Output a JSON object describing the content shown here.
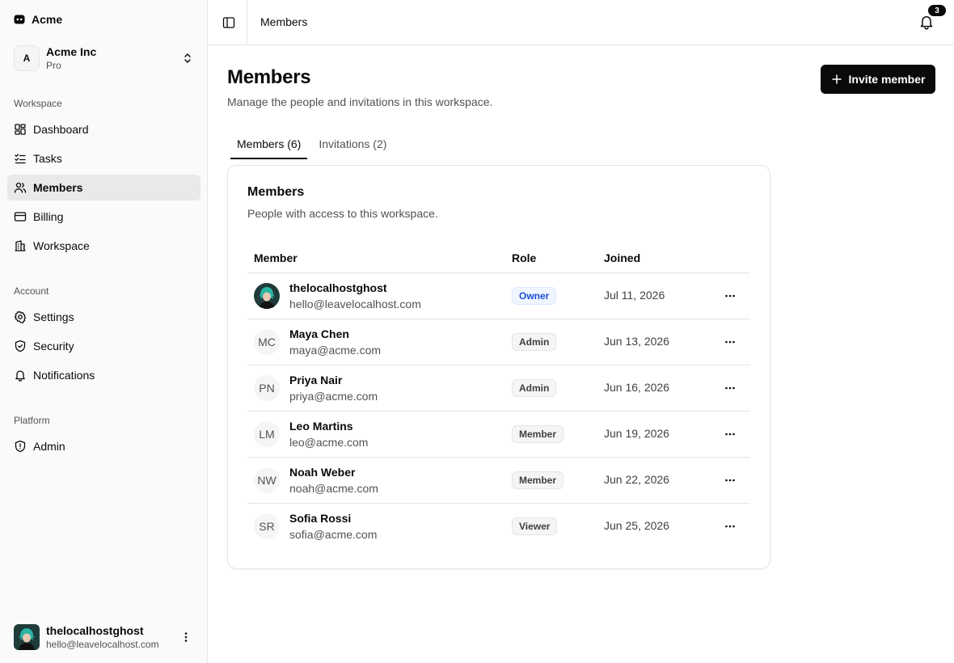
{
  "brand": {
    "name": "Acme"
  },
  "team": {
    "initial": "A",
    "name": "Acme Inc",
    "plan": "Pro"
  },
  "sidebar": {
    "groups": [
      {
        "label": "Workspace"
      },
      {
        "label": "Account"
      },
      {
        "label": "Platform"
      }
    ],
    "items": [
      {
        "label": "Dashboard",
        "icon": "dashboard-icon"
      },
      {
        "label": "Tasks",
        "icon": "tasks-icon"
      },
      {
        "label": "Members",
        "icon": "users-icon",
        "active": true
      },
      {
        "label": "Billing",
        "icon": "credit-card-icon"
      },
      {
        "label": "Workspace",
        "icon": "building-icon"
      },
      {
        "label": "Settings",
        "icon": "gear-icon"
      },
      {
        "label": "Security",
        "icon": "shield-icon"
      },
      {
        "label": "Notifications",
        "icon": "bell-icon"
      },
      {
        "label": "Admin",
        "icon": "shield-alert-icon"
      }
    ]
  },
  "user": {
    "name": "thelocalhostghost",
    "email": "hello@leavelocalhost.com"
  },
  "header": {
    "title": "Members",
    "notification_count": "3"
  },
  "page": {
    "title": "Members",
    "subtitle": "Manage the people and invitations in this workspace.",
    "invite_label": "Invite member"
  },
  "tabs": [
    {
      "label": "Members (6)",
      "active": true
    },
    {
      "label": "Invitations (2)",
      "active": false
    }
  ],
  "card": {
    "title": "Members",
    "description": "People with access to this workspace.",
    "columns": [
      "Member",
      "Role",
      "Joined"
    ],
    "rows": [
      {
        "initials": "",
        "name": "thelocalhostghost",
        "email": "hello@leavelocalhost.com",
        "role": "Owner",
        "joined": "Jul 11, 2026"
      },
      {
        "initials": "MC",
        "name": "Maya Chen",
        "email": "maya@acme.com",
        "role": "Admin",
        "joined": "Jun 13, 2026"
      },
      {
        "initials": "PN",
        "name": "Priya Nair",
        "email": "priya@acme.com",
        "role": "Admin",
        "joined": "Jun 16, 2026"
      },
      {
        "initials": "LM",
        "name": "Leo Martins",
        "email": "leo@acme.com",
        "role": "Member",
        "joined": "Jun 19, 2026"
      },
      {
        "initials": "NW",
        "name": "Noah Weber",
        "email": "noah@acme.com",
        "role": "Member",
        "joined": "Jun 22, 2026"
      },
      {
        "initials": "SR",
        "name": "Sofia Rossi",
        "email": "sofia@acme.com",
        "role": "Viewer",
        "joined": "Jun 25, 2026"
      }
    ]
  },
  "colors": {
    "accent": "#0a0a0a",
    "owner_badge": "#1d4ed8",
    "active_nav": "#e9e9e9"
  }
}
